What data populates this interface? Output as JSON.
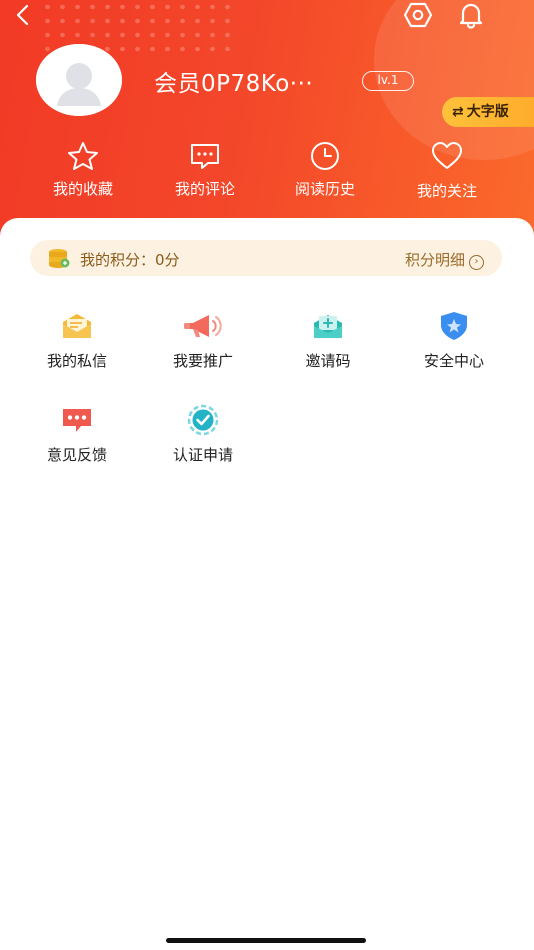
{
  "header": {
    "username": "会员0P78Ko···",
    "level": "lv.1",
    "big_font_label": "大字版",
    "big_font_icon": "⇄"
  },
  "quick_links": [
    {
      "label": "我的收藏",
      "icon": "star-icon"
    },
    {
      "label": "我的评论",
      "icon": "comment-icon"
    },
    {
      "label": "阅读历史",
      "icon": "clock-icon"
    },
    {
      "label": "我的关注",
      "icon": "heart-icon"
    }
  ],
  "points": {
    "label": "我的积分：",
    "value": "0分",
    "detail_label": "积分明细",
    "detail_arrow": "›"
  },
  "services": [
    {
      "label": "我的私信",
      "icon": "envelope-icon",
      "color": "#f5b93a"
    },
    {
      "label": "我要推广",
      "icon": "megaphone-icon",
      "color": "#f26a5b"
    },
    {
      "label": "邀请码",
      "icon": "invite-icon",
      "color": "#2bbab3"
    },
    {
      "label": "安全中心",
      "icon": "shield-icon",
      "color": "#3a8ef0"
    },
    {
      "label": "意见反馈",
      "icon": "feedback-icon",
      "color": "#f05a4e"
    },
    {
      "label": "认证申请",
      "icon": "verified-icon",
      "color": "#22b3c6"
    }
  ],
  "colors": {
    "header_start": "#f23a26",
    "header_end": "#fb6a2c",
    "points_bg": "#fdf2e2",
    "points_text": "#8a5a1a",
    "big_font_bg": "#ffb833"
  }
}
